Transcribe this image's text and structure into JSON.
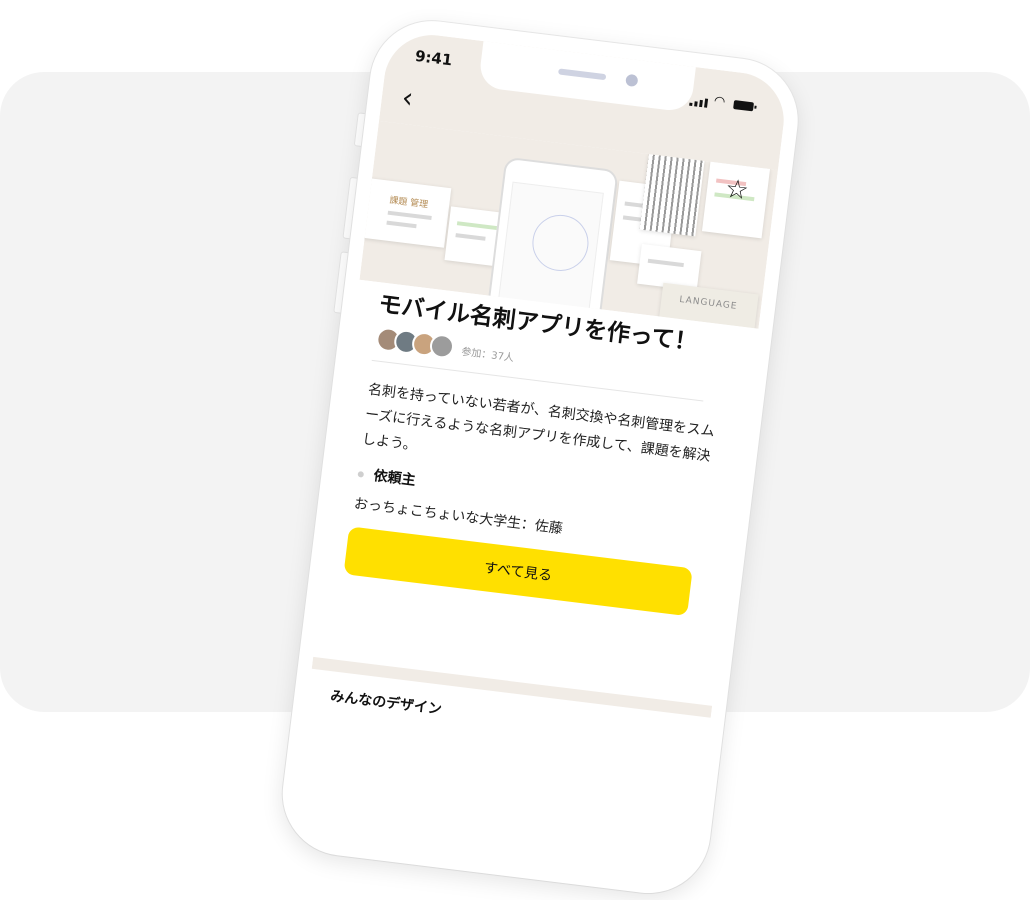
{
  "status_bar": {
    "time": "9:41"
  },
  "nav": {
    "back_icon": "chevron-left-icon",
    "favorite_icon": "star-icon"
  },
  "hero": {
    "label_jp": "課題 管理",
    "label_language": "LANGUAGE"
  },
  "project": {
    "title": "モバイル名刺アプリを作って！",
    "participants_text": "参加：37人",
    "description": "名刺を持っていない若者が、名刺交換や名刺管理をスムーズに行えるような名刺アプリを作成して、課題を解決しよう。",
    "requester_label": "依頼主",
    "requester_value": "おっちょこちょいな大学生：佐藤",
    "see_all_label": "すべて見る"
  },
  "section": {
    "title": "みんなのデザイン"
  },
  "colors": {
    "accent": "#ffe000",
    "header_bg": "#f1ece6",
    "backdrop": "#f3f3f3"
  }
}
